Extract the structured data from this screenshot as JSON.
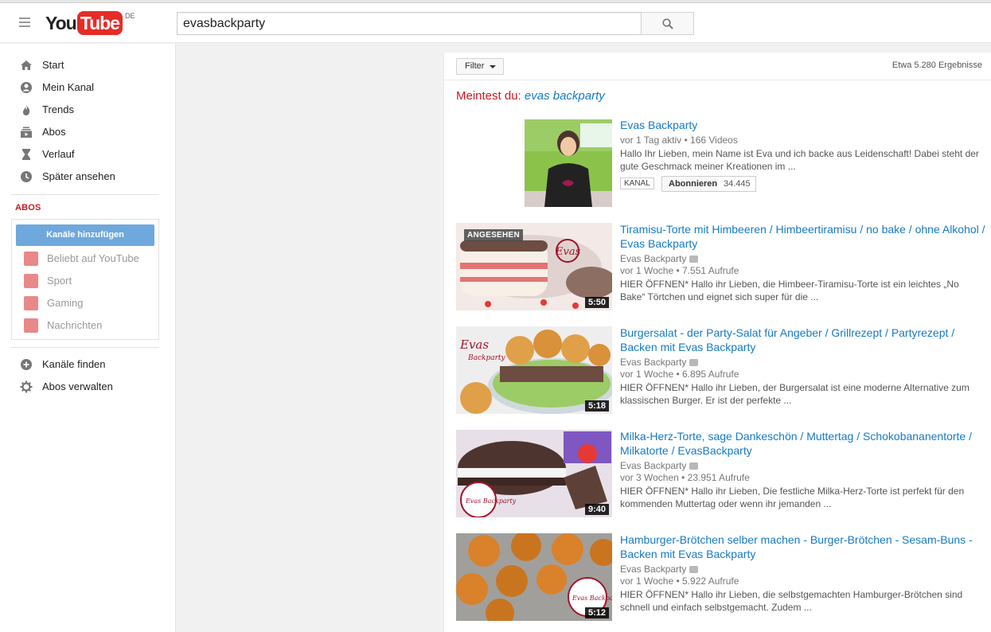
{
  "header": {
    "logo_you": "You",
    "logo_tube": "Tube",
    "logo_region": "DE",
    "search_value": "evasbackparty"
  },
  "sidebar": {
    "nav": [
      {
        "label": "Start",
        "icon": "home-icon"
      },
      {
        "label": "Mein Kanal",
        "icon": "account-icon"
      },
      {
        "label": "Trends",
        "icon": "flame-icon"
      },
      {
        "label": "Abos",
        "icon": "subscriptions-icon"
      },
      {
        "label": "Verlauf",
        "icon": "hourglass-icon"
      },
      {
        "label": "Später ansehen",
        "icon": "clock-icon"
      }
    ],
    "abos_heading": "ABOS",
    "add_channels": "Kanäle hinzufügen",
    "subs": [
      {
        "label": "Beliebt auf YouTube",
        "icon": "star-icon"
      },
      {
        "label": "Sport",
        "icon": "ball-icon"
      },
      {
        "label": "Gaming",
        "icon": "gamepad-icon"
      },
      {
        "label": "Nachrichten",
        "icon": "news-icon"
      }
    ],
    "bottom": [
      {
        "label": "Kanäle finden",
        "icon": "plus-circle-icon"
      },
      {
        "label": "Abos verwalten",
        "icon": "gear-icon"
      }
    ]
  },
  "results": {
    "filter_label": "Filter",
    "count": "Etwa 5.280 Ergebnisse",
    "did_you_mean_prefix": "Meintest du:",
    "did_you_mean_query": "evas backparty",
    "channel": {
      "title": "Evas Backparty",
      "meta": "vor 1 Tag aktiv • 166 Videos",
      "desc": "Hallo Ihr Lieben, mein Name ist Eva und ich backe aus Leidenschaft! Dabei steht der gute Geschmack meiner Kreationen im ...",
      "badge": "KANAL",
      "subscribe": "Abonnieren",
      "subscribers": "34.445"
    },
    "videos": [
      {
        "title": "Tiramisu-Torte mit Himbeeren / Himbeertiramisu / no bake / ohne Alkohol / Evas Backparty",
        "channel": "Evas Backparty",
        "meta": "vor 1 Woche • 7.551 Aufrufe",
        "desc": "HIER ÖFFNEN* Hallo ihr Lieben, die Himbeer-Tiramisu-Torte ist ein leichtes „No Bake“ Törtchen und eignet sich super für die ...",
        "duration": "5:50",
        "watched": "ANGESEHEN"
      },
      {
        "title": "Burgersalat - der Party-Salat für Angeber / Grillrezept / Partyrezept / Backen mit Evas Backparty",
        "channel": "Evas Backparty",
        "meta": "vor 1 Woche • 6.895 Aufrufe",
        "desc": "HIER ÖFFNEN* Hallo ihr Lieben, der Burgersalat ist eine moderne Alternative zum klassischen Burger. Er ist der perfekte ...",
        "duration": "5:18"
      },
      {
        "title": "Milka-Herz-Torte, sage Dankeschön / Muttertag / Schokobananentorte / Milkatorte / EvasBackparty",
        "channel": "Evas Backparty",
        "meta": "vor 3 Wochen • 23.951 Aufrufe",
        "desc": "HIER ÖFFNEN* Hallo ihr Lieben, Die festliche Milka-Herz-Torte ist perfekt für den kommenden Muttertag oder wenn ihr jemanden ...",
        "duration": "9:40"
      },
      {
        "title": "Hamburger-Brötchen selber machen - Burger-Brötchen - Sesam-Buns - Backen mit Evas Backparty",
        "channel": "Evas Backparty",
        "meta": "vor 1 Woche • 5.922 Aufrufe",
        "desc": "HIER ÖFFNEN* Hallo ihr Lieben, die selbstgemachten Hamburger-Brötchen sind schnell und einfach selbstgemacht. Zudem ...",
        "duration": "5:12"
      }
    ]
  },
  "colors": {
    "brand_red": "#e52d27",
    "link_blue": "#167ac6",
    "abos_red": "#cc181e",
    "add_button": "#6fa8dc"
  }
}
